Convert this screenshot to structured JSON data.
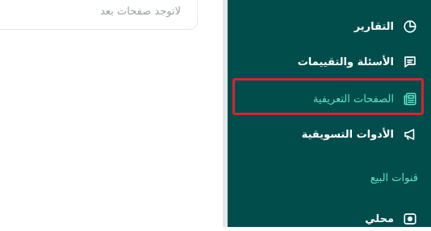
{
  "main": {
    "empty_state": "لاتوجد صفحات بعد"
  },
  "sidebar": {
    "items": [
      {
        "label": "التقارير",
        "icon": "pie-chart-icon"
      },
      {
        "label": "الأسئلة والتقييمات",
        "icon": "comment-icon"
      },
      {
        "label": "الصفحات التعريفية",
        "icon": "newspaper-icon",
        "active": true
      },
      {
        "label": "الأدوات التسويقية",
        "icon": "megaphone-icon"
      }
    ],
    "section_title": "قنوات البيع",
    "channel_items": [
      {
        "label": "محلي",
        "icon": "store-icon"
      }
    ]
  },
  "colors": {
    "sidebar_bg": "#004d4c",
    "accent": "#5fe3c4",
    "highlight": "#d9232d"
  }
}
